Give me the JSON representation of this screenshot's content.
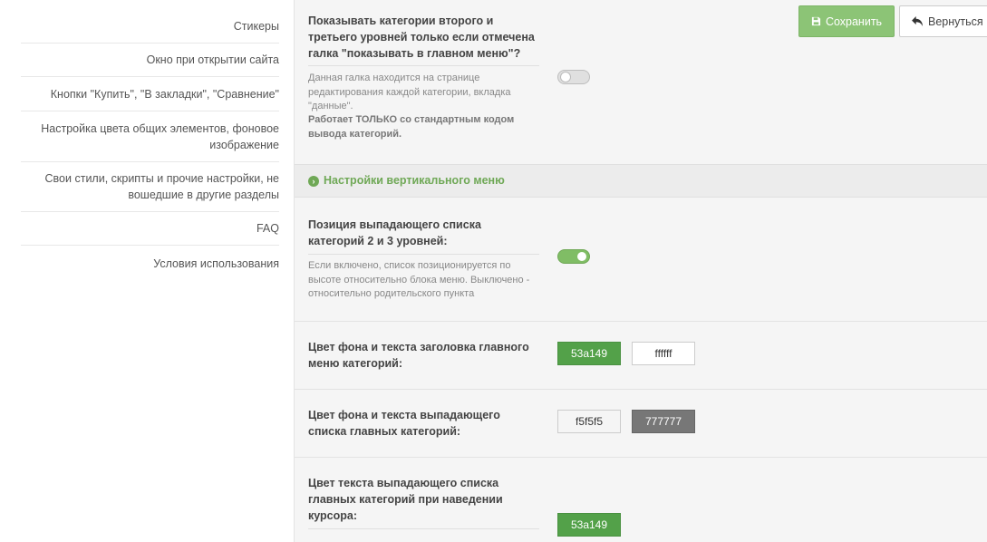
{
  "sidebar": {
    "items": [
      {
        "label": "Стикеры"
      },
      {
        "label": "Окно при открытии сайта"
      },
      {
        "label": "Кнопки \"Купить\", \"В закладки\", \"Сравнение\""
      },
      {
        "label": "Настройка цвета общих элементов, фоновое изображение"
      },
      {
        "label": "Свои стили, скрипты и прочие настройки, не вошедшие в другие разделы"
      },
      {
        "label": "FAQ"
      },
      {
        "label": "Условия использования"
      }
    ]
  },
  "toolbar": {
    "save_label": "Сохранить",
    "back_label": "Вернуться"
  },
  "settings": {
    "show_categories": {
      "title": "Показывать категории второго и третьего уровней только если отмечена галка \"показывать в главном меню\"?",
      "help": "Данная галка находится на странице редактирования каждой категории, вкладка \"данные\".",
      "help_bold": "Работает ТОЛЬКО со стандартным кодом вывода категорий.",
      "enabled": false
    },
    "section_vertical_menu": "Настройки вертикального меню",
    "dropdown_position": {
      "title": "Позиция выпадающего списка категорий 2 и 3 уровней:",
      "help": "Если включено, список позиционируется по высоте относительно блока меню. Выключено - относительно родительского пункта",
      "enabled": true
    },
    "header_colors": {
      "title": "Цвет фона и текста заголовка главного меню категорий:",
      "bg": "53a149",
      "text": "ffffff"
    },
    "dropdown_colors": {
      "title": "Цвет фона и текста выпадающего списка главных категорий:",
      "bg": "f5f5f5",
      "text": "777777"
    },
    "hover_color": {
      "title": "Цвет текста выпадающего списка главных категорий при наведении курсора:",
      "value": "53a149"
    }
  },
  "colors": {
    "accent": "#6fa856",
    "save_button": "#8cc476",
    "swatch_green": "#53a149",
    "swatch_white": "#ffffff",
    "swatch_light": "#f5f5f5",
    "swatch_gray": "#777777"
  }
}
